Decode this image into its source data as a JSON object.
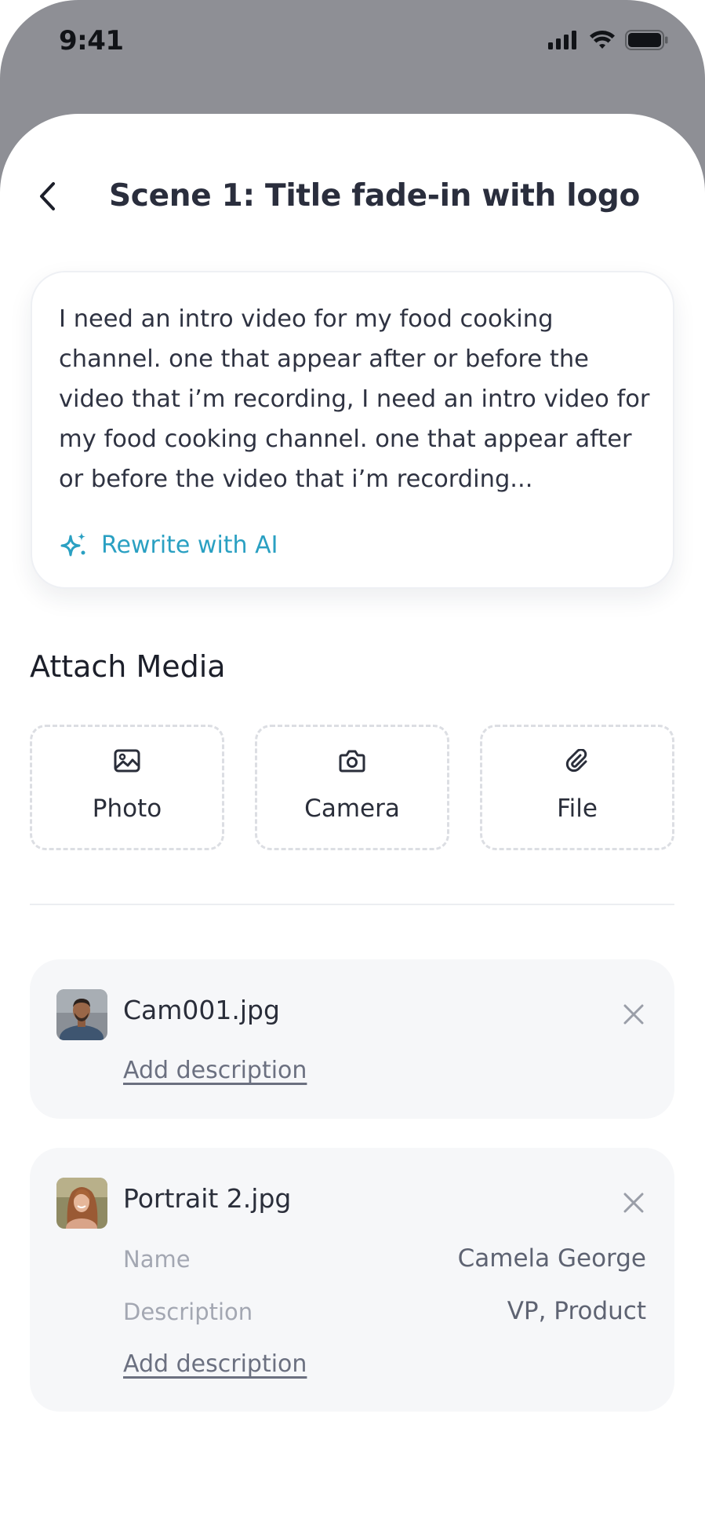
{
  "status_bar": {
    "time": "9:41",
    "icons": [
      "signal-icon",
      "wifi-icon",
      "battery-icon"
    ]
  },
  "header": {
    "back_icon": "chevron-left-icon",
    "title": "Scene 1: Title fade-in with logo"
  },
  "prompt": {
    "text": "I need an intro video for my food cooking channel. one that appear after or before the video that i’m recording, I need an intro video for my food cooking channel. one that appear after or before the video that i’m recording...",
    "rewrite_label": "Rewrite with AI",
    "rewrite_icon": "sparkle-icon"
  },
  "attach": {
    "title": "Attach Media",
    "options": [
      {
        "label": "Photo",
        "icon": "image-icon"
      },
      {
        "label": "Camera",
        "icon": "camera-icon"
      },
      {
        "label": "File",
        "icon": "paperclip-icon"
      }
    ]
  },
  "files": [
    {
      "name": "Cam001.jpg",
      "add_description": "Add description"
    },
    {
      "name": "Portrait 2.jpg",
      "fields": [
        {
          "label": "Name",
          "value": "Camela George"
        },
        {
          "label": "Description",
          "value": "VP, Product"
        }
      ],
      "add_description": "Add description"
    }
  ],
  "colors": {
    "accent": "#2aa0c2",
    "backdrop": "#8e8f95",
    "card_bg": "#f6f7f9",
    "text_primary": "#2a2e3a"
  }
}
